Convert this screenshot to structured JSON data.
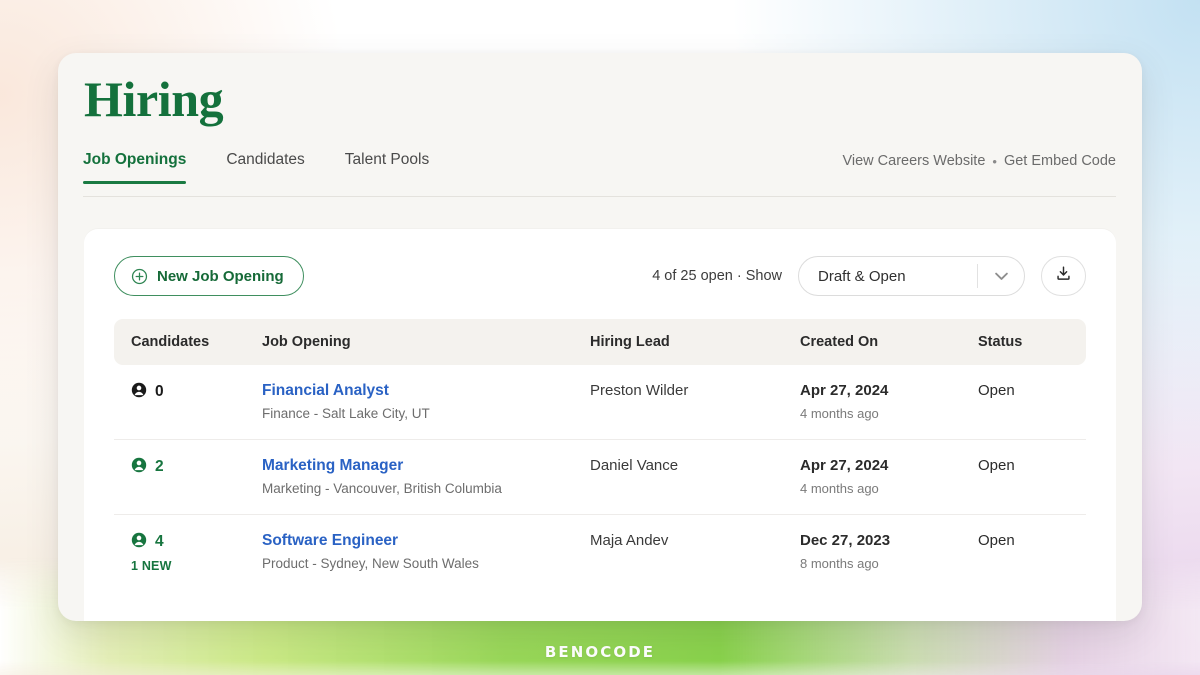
{
  "header": {
    "title": "Hiring",
    "tabs": [
      {
        "label": "Job Openings",
        "active": true
      },
      {
        "label": "Candidates",
        "active": false
      },
      {
        "label": "Talent Pools",
        "active": false
      }
    ],
    "links": {
      "careers": "View Careers Website",
      "separator": "•",
      "embed": "Get Embed Code"
    }
  },
  "toolbar": {
    "new_job_label": "New Job Opening",
    "new_job_icon": "plus-circle-icon",
    "count_text": "4 of 25 open · Show",
    "filter_value": "Draft & Open",
    "filter_options": [
      "Draft & Open"
    ],
    "download_icon": "download-icon"
  },
  "table": {
    "columns": [
      "Candidates",
      "Job Opening",
      "Hiring Lead",
      "Created On",
      "Status"
    ],
    "rows": [
      {
        "candidates": "0",
        "candidates_green": false,
        "new_badge": "",
        "job_title": "Financial Analyst",
        "job_sub": "Finance - Salt Lake City, UT",
        "hiring_lead": "Preston Wilder",
        "created_date": "Apr 27, 2024",
        "created_relative": "4 months ago",
        "status": "Open"
      },
      {
        "candidates": "2",
        "candidates_green": true,
        "new_badge": "",
        "job_title": "Marketing Manager",
        "job_sub": "Marketing - Vancouver, British Columbia",
        "hiring_lead": "Daniel Vance",
        "created_date": "Apr 27, 2024",
        "created_relative": "4 months ago",
        "status": "Open"
      },
      {
        "candidates": "4",
        "candidates_green": true,
        "new_badge": "1 NEW",
        "job_title": "Software Engineer",
        "job_sub": "Product - Sydney, New South Wales",
        "hiring_lead": "Maja Andev",
        "created_date": "Dec 27, 2023",
        "created_relative": "8 months ago",
        "status": "Open"
      }
    ]
  },
  "watermark": {
    "text": "BENOCODE"
  },
  "colors": {
    "brand_green": "#14713c",
    "tab_underline": "#1a7a42",
    "link_blue": "#2a62c4",
    "card_bg": "#f7f6f3",
    "table_head_bg": "#f4f2ee"
  }
}
